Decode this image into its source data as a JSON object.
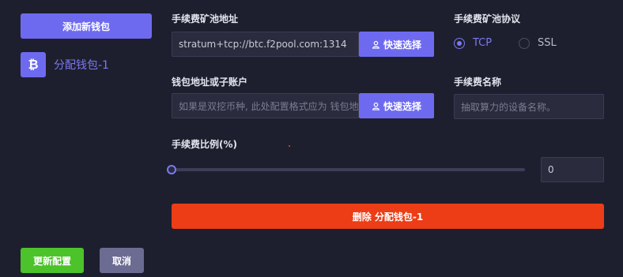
{
  "sidebar": {
    "add_wallet_label": "添加新钱包",
    "wallet_icon_glyph": "₿",
    "wallets": [
      {
        "label": "分配钱包-1",
        "selected": true
      }
    ]
  },
  "form": {
    "pool_address": {
      "label": "手续费矿池地址",
      "value": "stratum+tcp://btc.f2pool.com:1314",
      "quick_select_label": "快速选择"
    },
    "pool_protocol": {
      "label": "手续费矿池协议",
      "options": [
        {
          "label": "TCP",
          "checked": true
        },
        {
          "label": "SSL",
          "checked": false
        }
      ]
    },
    "wallet_address": {
      "label": "钱包地址或子账户",
      "placeholder": "如果是双挖币种, 此处配置格式应为 钱包地",
      "quick_select_label": "快速选择"
    },
    "fee_name": {
      "label": "手续费名称",
      "placeholder": "抽取算力的设备名称。"
    },
    "fee_ratio": {
      "label": "手续费比例(%)",
      "slider_fraction": 0,
      "value": "0"
    },
    "delete_label": "删除 分配钱包-1"
  },
  "footer": {
    "save_label": "更新配置",
    "cancel_label": "取消"
  },
  "colors": {
    "background": "#1e1f2e",
    "accent": "#6e6af0",
    "danger": "#ec3d16",
    "success": "#4cc22b",
    "muted_button": "#6c6b92"
  }
}
